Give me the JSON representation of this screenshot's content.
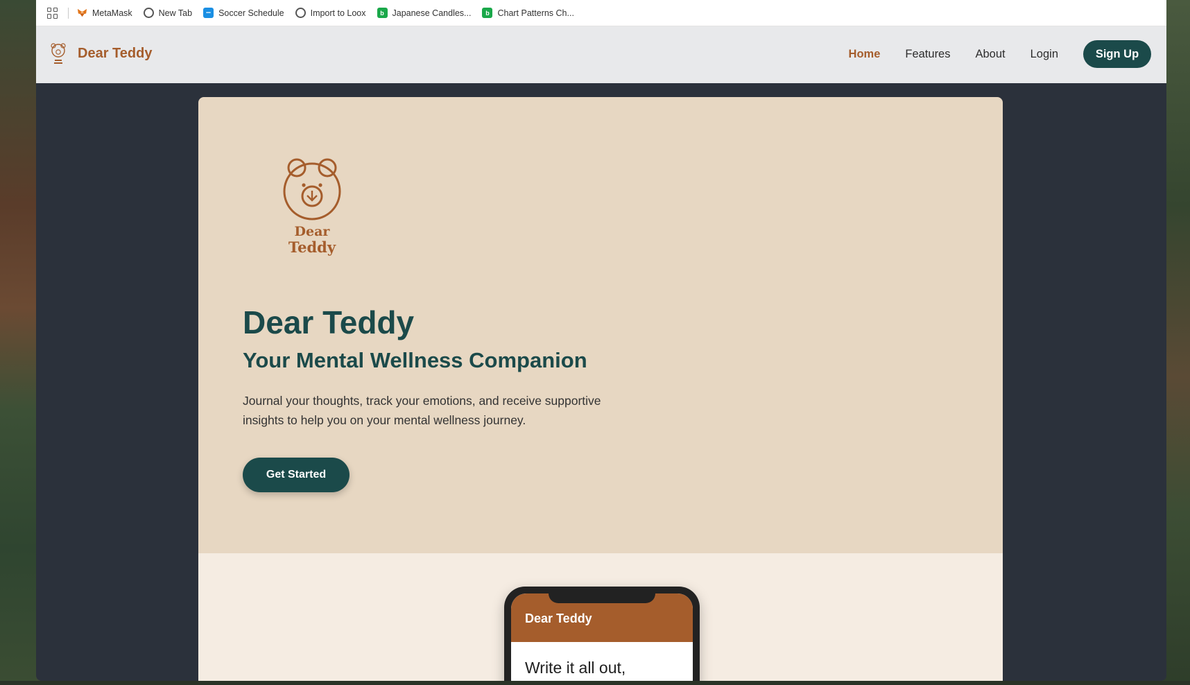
{
  "bookmarks": [
    {
      "label": "MetaMask",
      "icon": "metamask-fox-icon"
    },
    {
      "label": "New Tab",
      "icon": "globe-icon"
    },
    {
      "label": "Soccer Schedule",
      "icon": "soccer-schedule-icon"
    },
    {
      "label": "Import to Loox",
      "icon": "globe-icon"
    },
    {
      "label": "Japanese Candles...",
      "icon": "b-green-icon"
    },
    {
      "label": "Chart Patterns Ch...",
      "icon": "b-green-icon"
    }
  ],
  "nav": {
    "brand": "Dear Teddy",
    "links": [
      "Home",
      "Features",
      "About",
      "Login"
    ],
    "active": "Home",
    "signup": "Sign Up"
  },
  "hero": {
    "logo_text_line1": "Dear",
    "logo_text_line2": "Teddy",
    "title": "Dear Teddy",
    "subtitle": "Your Mental Wellness Companion",
    "description": "Journal your thoughts, track your emotions, and receive supportive insights to help you on your mental wellness journey.",
    "cta": "Get Started"
  },
  "phone": {
    "header": "Dear Teddy",
    "body": "Write it all out,"
  },
  "colors": {
    "brand_brown": "#a55d2c",
    "brand_teal": "#1b4a4a",
    "hero_bg": "#e7d7c2",
    "lower_bg": "#f5ece2",
    "page_bg": "#2b313b"
  }
}
